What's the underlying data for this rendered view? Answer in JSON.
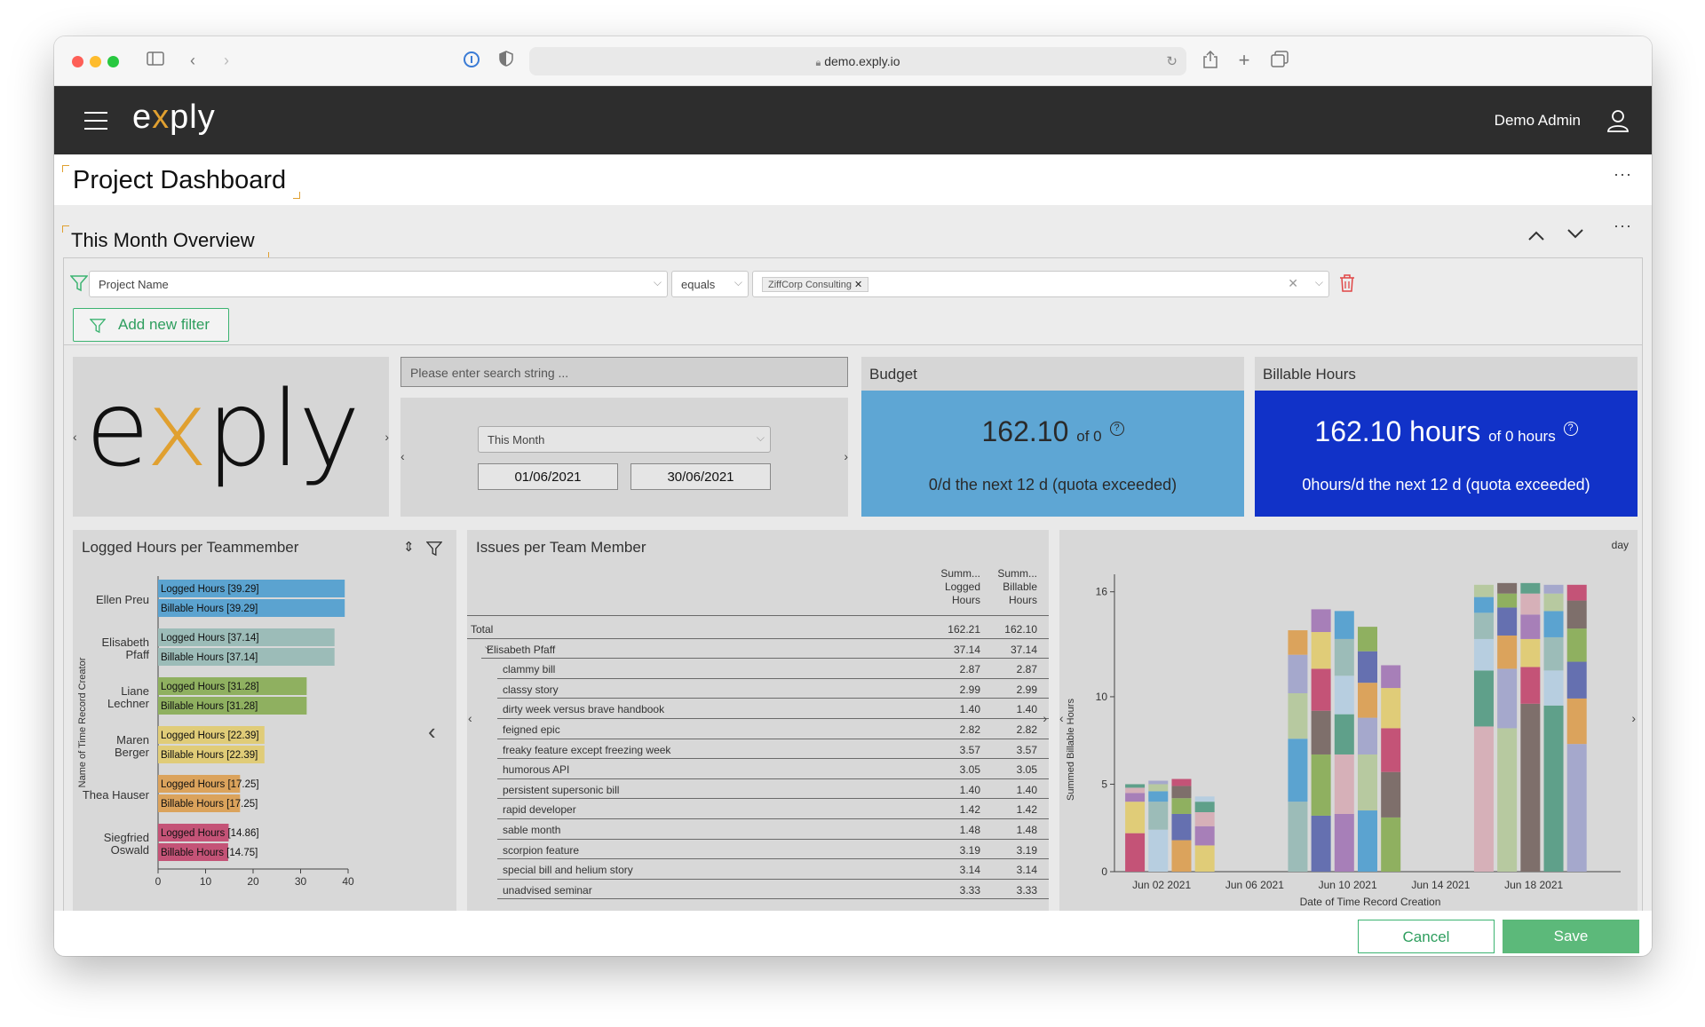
{
  "browser": {
    "url": "demo.exply.io"
  },
  "header": {
    "logo": "exply",
    "user_name": "Demo Admin"
  },
  "page": {
    "title": "Project Dashboard",
    "section_title": "This Month Overview",
    "more": "···"
  },
  "filter": {
    "field": "Project Name",
    "operator": "equals",
    "value_chip": "ZiffCorp Consulting",
    "add_label": "Add new filter"
  },
  "search": {
    "placeholder": "Please enter search string ..."
  },
  "dates": {
    "period": "This Month",
    "from": "01/06/2021",
    "to": "30/06/2021"
  },
  "budget": {
    "title": "Budget",
    "value": "162.10",
    "of": "of 0",
    "sub": "0/d the next 12 d (quota exceeded)"
  },
  "billable": {
    "title": "Billable Hours",
    "value": "162.10 hours",
    "of": "of 0 hours",
    "sub": "0hours/d the next 12 d (quota exceeded)"
  },
  "footer": {
    "cancel": "Cancel",
    "save": "Save"
  },
  "issues": {
    "title": "Issues per Team Member",
    "col1": [
      "Summ...",
      "Logged",
      "Hours"
    ],
    "col2": [
      "Summ...",
      "Billable",
      "Hours"
    ],
    "rows": [
      {
        "label": "Total",
        "a": "162.21",
        "b": "162.10",
        "level": 0
      },
      {
        "label": "Elisabeth Pfaff",
        "a": "37.14",
        "b": "37.14",
        "level": 1
      },
      {
        "label": "clammy bill",
        "a": "2.87",
        "b": "2.87",
        "level": 2
      },
      {
        "label": "classy story",
        "a": "2.99",
        "b": "2.99",
        "level": 2
      },
      {
        "label": "dirty week versus brave handbook",
        "a": "1.40",
        "b": "1.40",
        "level": 2
      },
      {
        "label": "feigned epic",
        "a": "2.82",
        "b": "2.82",
        "level": 2
      },
      {
        "label": "freaky feature except freezing week",
        "a": "3.57",
        "b": "3.57",
        "level": 2
      },
      {
        "label": "humorous API",
        "a": "3.05",
        "b": "3.05",
        "level": 2
      },
      {
        "label": "persistent supersonic bill",
        "a": "1.40",
        "b": "1.40",
        "level": 2
      },
      {
        "label": "rapid developer",
        "a": "1.42",
        "b": "1.42",
        "level": 2
      },
      {
        "label": "sable month",
        "a": "1.48",
        "b": "1.48",
        "level": 2
      },
      {
        "label": "scorpion feature",
        "a": "3.19",
        "b": "3.19",
        "level": 2
      },
      {
        "label": "special bill and helium story",
        "a": "3.14",
        "b": "3.14",
        "level": 2
      },
      {
        "label": "unadvised seminar",
        "a": "3.33",
        "b": "3.33",
        "level": 2
      }
    ]
  },
  "chart_data": [
    {
      "type": "bar",
      "title": "Logged Hours per Teammember",
      "ylabel": "Name of Time Record Creator",
      "xlim": [
        0,
        40
      ],
      "xticks": [
        0,
        10,
        20,
        30,
        40
      ],
      "categories": [
        [
          "Ellen Preu"
        ],
        [
          "Elisabeth",
          "Pfaff"
        ],
        [
          "Liane",
          "Lechner"
        ],
        [
          "Maren",
          "Berger"
        ],
        [
          "Thea Hauser"
        ],
        [
          "Siegfried",
          "Oswald"
        ]
      ],
      "colors": [
        "#5ba3d0",
        "#9cbcb8",
        "#8fb060",
        "#e0cc78",
        "#dba35c",
        "#c45377"
      ],
      "series": [
        {
          "name": "Logged Hours",
          "values": [
            39.29,
            37.14,
            31.28,
            22.39,
            17.25,
            14.86
          ]
        },
        {
          "name": "Billable Hours",
          "values": [
            39.29,
            37.14,
            31.28,
            22.39,
            17.25,
            14.75
          ]
        }
      ]
    },
    {
      "type": "bar",
      "stacked": true,
      "ylabel": "Summed Billable Hours",
      "xlabel": "Date of Time Record Creation",
      "granularity": "day",
      "ylim": [
        0,
        17
      ],
      "yticks": [
        0,
        5,
        10,
        16
      ],
      "xtick_labels": [
        "Jun 02 2021",
        "Jun 06 2021",
        "Jun 10 2021",
        "Jun 14 2021",
        "Jun 18 2021"
      ],
      "palette": [
        "#c45377",
        "#b7cee0",
        "#dba35c",
        "#e0cc78",
        "#9cbcb8",
        "#6570b0",
        "#a77fb8",
        "#5ba3d0",
        "#8fb060",
        "#d6b0b8",
        "#b7c9a0",
        "#7e6f6b",
        "#5fa08a",
        "#a5a8cc"
      ],
      "stacks": [
        {
          "x": 1,
          "segments": [
            2.2,
            1.8,
            0.5,
            0.3,
            0.2
          ]
        },
        {
          "x": 2,
          "segments": [
            2.4,
            1.6,
            0.6,
            0.4,
            0.2
          ]
        },
        {
          "x": 3,
          "segments": [
            1.8,
            1.5,
            0.9,
            0.7,
            0.4
          ]
        },
        {
          "x": 4,
          "segments": [
            1.5,
            1.1,
            0.8,
            0.6,
            0.3
          ]
        },
        {
          "x": 8,
          "segments": [
            4.0,
            3.6,
            2.6,
            2.2,
            1.4
          ]
        },
        {
          "x": 9,
          "segments": [
            3.2,
            3.5,
            2.5,
            2.4,
            2.1,
            1.3
          ]
        },
        {
          "x": 10,
          "segments": [
            3.3,
            3.4,
            2.3,
            2.2,
            2.1,
            1.6
          ]
        },
        {
          "x": 11,
          "segments": [
            3.5,
            3.2,
            2.1,
            2.0,
            1.8,
            1.4
          ]
        },
        {
          "x": 12,
          "segments": [
            3.1,
            2.6,
            2.5,
            2.3,
            1.3
          ]
        },
        {
          "x": 16,
          "segments": [
            8.3,
            3.2,
            1.8,
            1.5,
            0.9,
            0.7
          ]
        },
        {
          "x": 17,
          "segments": [
            8.2,
            3.4,
            1.9,
            1.6,
            0.8,
            0.6
          ]
        },
        {
          "x": 18,
          "segments": [
            9.6,
            2.1,
            1.6,
            1.4,
            1.2,
            0.6
          ]
        },
        {
          "x": 19,
          "segments": [
            9.5,
            2.0,
            1.9,
            1.5,
            1.0,
            0.5
          ]
        },
        {
          "x": 20,
          "segments": [
            7.3,
            2.6,
            2.1,
            1.9,
            1.6,
            0.9
          ]
        }
      ]
    }
  ]
}
